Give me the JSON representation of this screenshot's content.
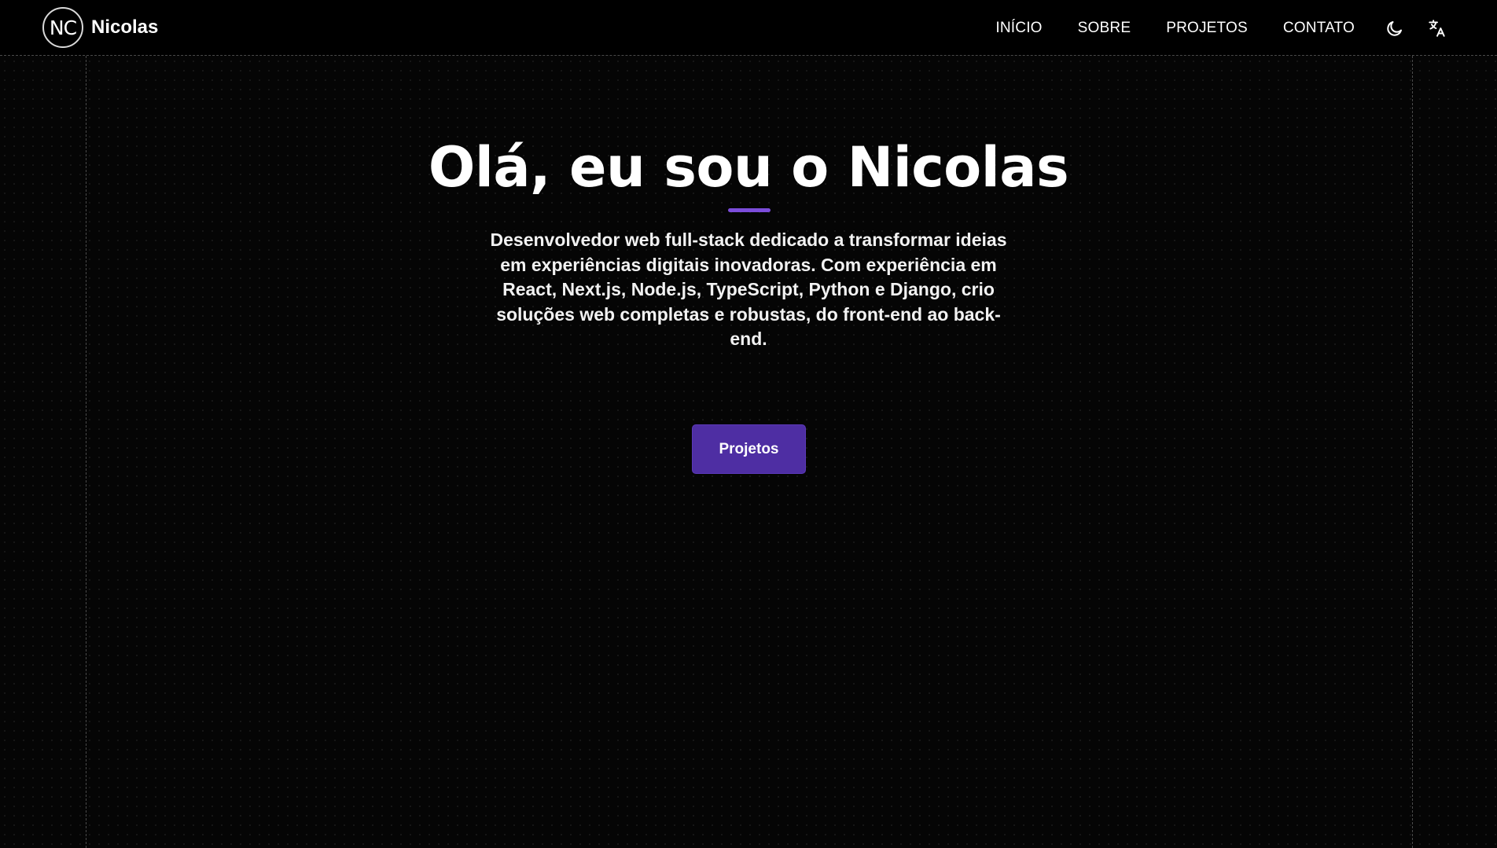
{
  "header": {
    "logo_text": "NC",
    "brand_name": "Nicolas",
    "nav": [
      {
        "label": "INÍCIO"
      },
      {
        "label": "SOBRE"
      },
      {
        "label": "PROJETOS"
      },
      {
        "label": "CONTATO"
      }
    ],
    "icons": {
      "theme": "moon-icon",
      "language": "translate-icon"
    }
  },
  "hero": {
    "title": "Olá, eu sou o Nicolas",
    "description": "Desenvolvedor web full-stack dedicado a transformar ideias em experiências digitais inovadoras. Com experiência em React, Next.js, Node.js, TypeScript, Python e Django, crio soluções web completas e robustas, do front-end ao back-end.",
    "cta_label": "Projetos"
  },
  "colors": {
    "background": "#050505",
    "accent": "#7c4ddb",
    "button": "#4e2ea3"
  }
}
